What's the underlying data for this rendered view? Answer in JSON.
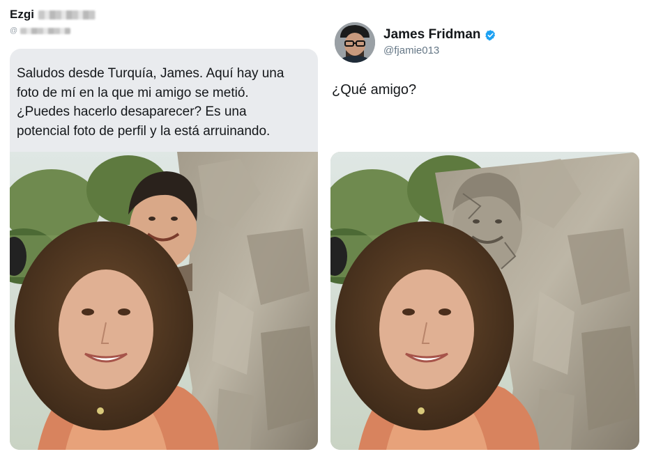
{
  "left_tweet": {
    "name": "Ezgi",
    "handle_prefix": "@",
    "text": "Saludos desde Turquía, James. Aquí hay una\nfoto de mí en la que mi amigo se metió.\n¿Puedes hacerlo desaparecer? Es una\npotencial foto de perfil y la está arruinando.",
    "photo_icon": "woman-with-friend-photo"
  },
  "right_tweet": {
    "name": "James Fridman",
    "verified_icon": "verified-badge-icon",
    "handle": "@fjamie013",
    "text": "¿Qué amigo?",
    "photo_icon": "edited-photo-friend-as-rock"
  },
  "colors": {
    "bubble_bg": "#e9ebee",
    "verified_blue": "#1da1f2",
    "handle_gray": "#657786"
  }
}
